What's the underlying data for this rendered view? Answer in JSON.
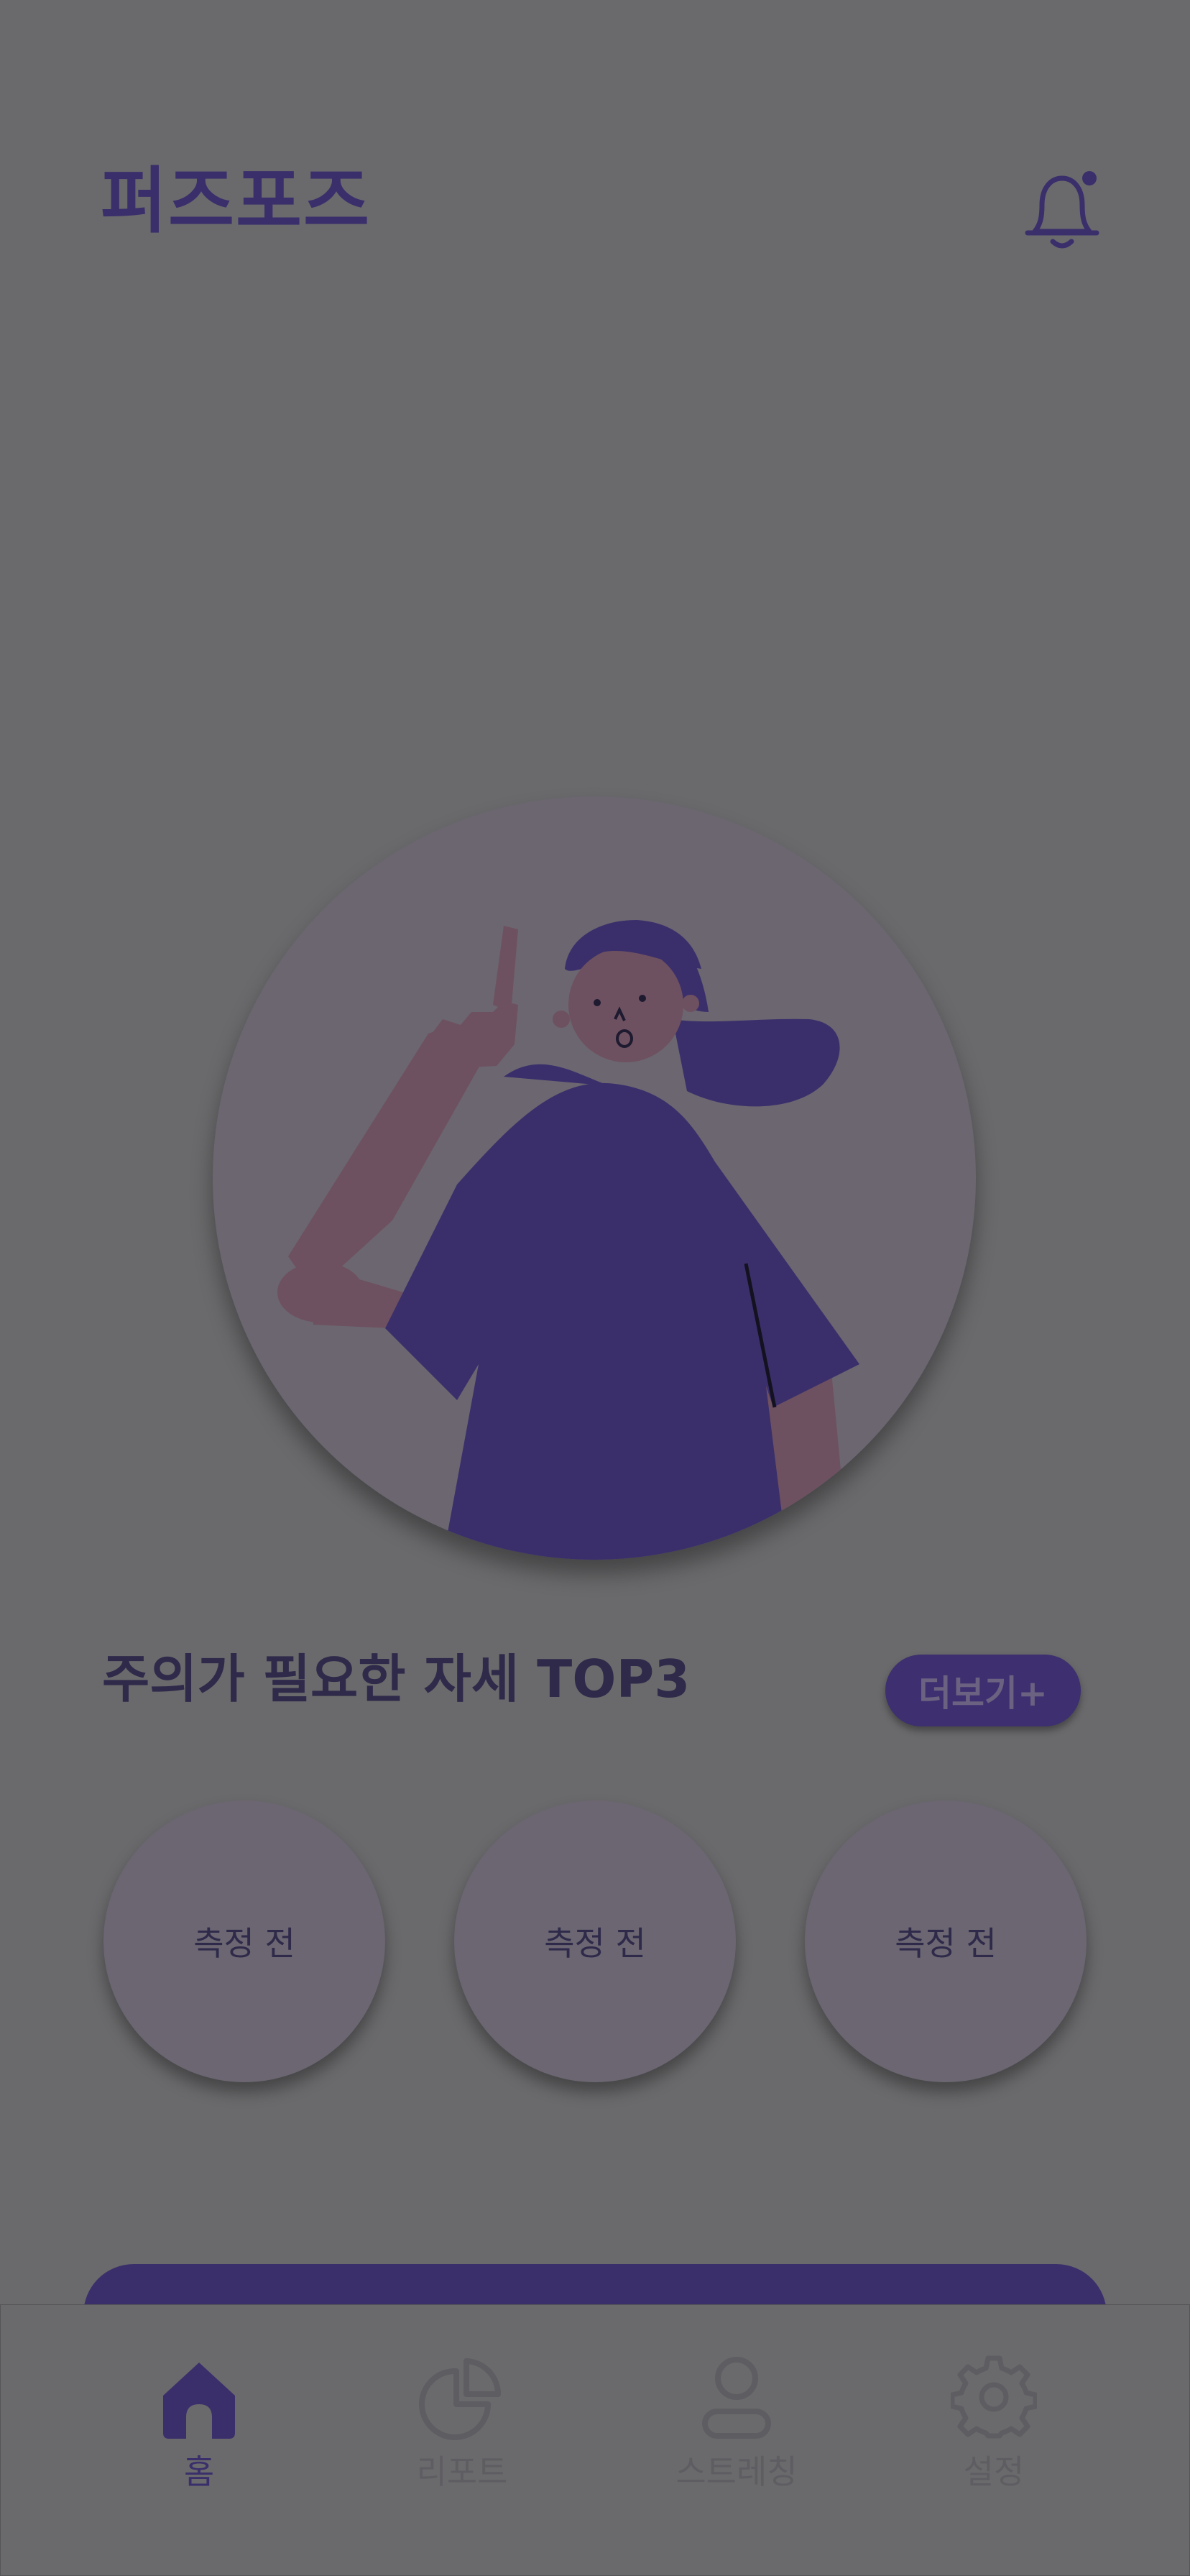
{
  "header": {
    "logo_text": "퍼즈포즈",
    "notification_icon": "bell-icon",
    "notification_badge": true
  },
  "hero": {
    "illustration": "woman-pointing-up"
  },
  "top3": {
    "title": "주의가 필요한 자세 TOP3",
    "more_label": "더보기+",
    "items": [
      {
        "label": "측정 전"
      },
      {
        "label": "측정 전"
      },
      {
        "label": "측정 전"
      }
    ]
  },
  "tabbar": {
    "active": "홈",
    "tabs": [
      {
        "label": "홈",
        "icon": "home-icon"
      },
      {
        "label": "리포트",
        "icon": "pie-chart-icon"
      },
      {
        "label": "스트레칭",
        "icon": "person-icon"
      },
      {
        "label": "설정",
        "icon": "gear-icon"
      }
    ]
  },
  "colors": {
    "brand": "#3b2f6b",
    "overlay_background": "#6a6a6c",
    "text_dark": "#2f2a4a",
    "inactive": "#5e5d62"
  }
}
